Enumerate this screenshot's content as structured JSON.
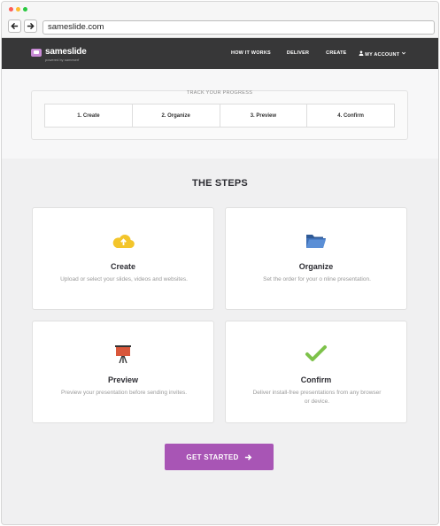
{
  "browser": {
    "url": "sameslide.com",
    "dot_colors": [
      "#fd5f57",
      "#febc2e",
      "#28c840"
    ]
  },
  "header": {
    "brand": "sameslide",
    "brand_sub": "powered by sameserf",
    "menu": [
      "HOW IT WORKS",
      "DELIVER",
      "CREATE",
      "MY ACCOUNT"
    ]
  },
  "progress": {
    "title": "TRACK YOUR PROGRESS",
    "steps": [
      "1. Create",
      "2. Organize",
      "3. Preview",
      "4. Confirm"
    ]
  },
  "steps_section": {
    "title": "THE STEPS",
    "cards": [
      {
        "title": "Create",
        "desc": "Upload or select your slides, videos and websites.",
        "icon": "cloud-upload-icon",
        "color": "#f3c52b"
      },
      {
        "title": "Organize",
        "desc": "Set the order for your o nline presentation.",
        "icon": "folder-icon",
        "color": "#3d6fb6"
      },
      {
        "title": "Preview",
        "desc": "Preview your presentation before sending invites.",
        "icon": "presentation-easel-icon",
        "color": "#d9573b"
      },
      {
        "title": "Confirm",
        "desc": "Deliver install-free presentations from any browser or device.",
        "icon": "checkmark-icon",
        "color": "#7dc24a"
      }
    ]
  },
  "cta": {
    "label": "GET STARTED",
    "color": "#a855b5"
  }
}
